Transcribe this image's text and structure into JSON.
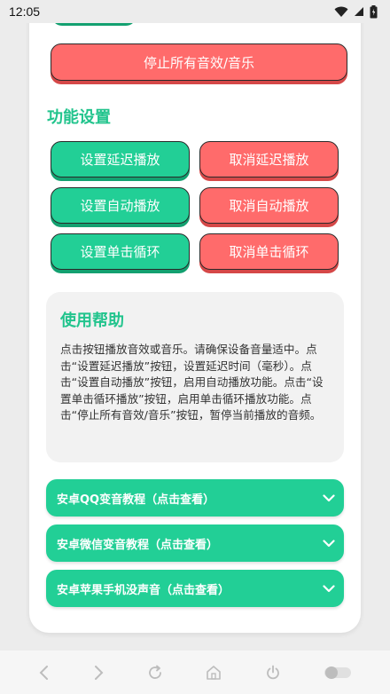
{
  "status": {
    "time": "12:05"
  },
  "buttons": {
    "stop_all": "停止所有音效/音乐",
    "set_delay": "设置延迟播放",
    "cancel_delay": "取消延迟播放",
    "set_auto": "设置自动播放",
    "cancel_auto": "取消自动播放",
    "set_loop": "设置单击循环",
    "cancel_loop": "取消单击循环"
  },
  "section": {
    "title": "功能设置"
  },
  "help": {
    "title": "使用帮助",
    "text": "点击按钮播放音效或音乐。请确保设备音量适中。点击“设置延迟播放”按钮，设置延迟时间（毫秒）。点击“设置自动播放”按钮，启用自动播放功能。点击“设置单击循环播放”按钮，启用单击循环播放功能。点击“停止所有音效/音乐”按钮，暂停当前播放的音频。"
  },
  "accordions": [
    {
      "label": "安卓QQ变音教程（点击查看）"
    },
    {
      "label": "安卓微信变音教程（点击查看）"
    },
    {
      "label": "安卓苹果手机没声音（点击查看）"
    }
  ],
  "colors": {
    "green": "#22cf96",
    "red": "#ff6b6b",
    "title_green": "#22c48d"
  }
}
